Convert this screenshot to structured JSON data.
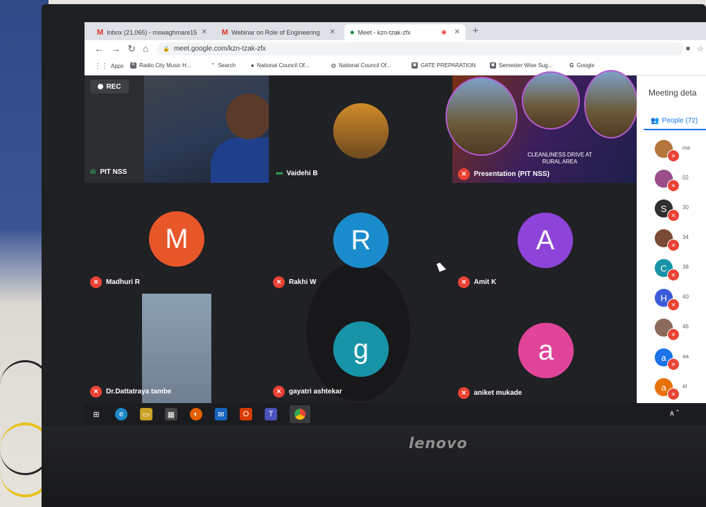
{
  "browser": {
    "tabs": [
      {
        "label": "Inbox (21,065) - mswaghmare15",
        "icon": "gmail-icon"
      },
      {
        "label": "Webinar on Role of Engineering",
        "icon": "gmail-icon"
      },
      {
        "label": "Meet - kzn-tzak-zfx",
        "icon": "meet-icon"
      }
    ],
    "url": "meet.google.com/kzn-tzak-zfx",
    "bookmarks": [
      "Apps",
      "Radio City Music H...",
      "Search",
      "National Council Of...",
      "National Council Of...",
      "GATE PREPARATION",
      "Semester Wise Sug...",
      "Google"
    ]
  },
  "meet": {
    "rec_label": "REC",
    "tiles": [
      {
        "name": "PIT NSS",
        "type": "video"
      },
      {
        "name": "Vaidehi B",
        "type": "thumbnail"
      },
      {
        "name": "Presentation (PIT NSS)",
        "type": "presentation",
        "slide_text": "CLEANLINESS DRIVE AT RURAL AREA"
      },
      {
        "name": "Madhuri R",
        "initial": "M",
        "color": "#e8572a"
      },
      {
        "name": "Rakhi W",
        "initial": "R",
        "color": "#1a8ccc"
      },
      {
        "name": "Amit K",
        "initial": "A",
        "color": "#8e44d8"
      },
      {
        "name": "Dr.Dattatraya tambe",
        "type": "video"
      },
      {
        "name": "gayatri ashtekar",
        "initial": "g",
        "color": "#1894a8"
      },
      {
        "name": "aniket mukade",
        "initial": "a",
        "color": "#e0459a"
      }
    ]
  },
  "panel": {
    "title": "Meeting deta",
    "people_tab": "People (72)",
    "rows": [
      {
        "initial": "",
        "color": "#b5763e",
        "text": "ma"
      },
      {
        "initial": "",
        "color": "#9b4f8a",
        "text": "02"
      },
      {
        "initial": "S",
        "color": "#2f2f2f",
        "text": "30"
      },
      {
        "initial": "",
        "color": "#7a4a35",
        "text": "34"
      },
      {
        "initial": "C",
        "color": "#1894a8",
        "text": "38"
      },
      {
        "initial": "H",
        "color": "#3b5bdb",
        "text": "40"
      },
      {
        "initial": "",
        "color": "#8a6a5a",
        "text": "46"
      },
      {
        "initial": "a",
        "color": "#1a73e8",
        "text": "aa"
      },
      {
        "initial": "a",
        "color": "#e8710a",
        "text": "al"
      }
    ]
  },
  "taskbar": {
    "icons": [
      "windows-icon",
      "edge-icon",
      "file-explorer-icon",
      "store-icon",
      "firefox-icon",
      "mail-icon",
      "office-icon",
      "teams-icon",
      "chrome-icon"
    ]
  },
  "laptop": {
    "brand": "lenovo"
  }
}
